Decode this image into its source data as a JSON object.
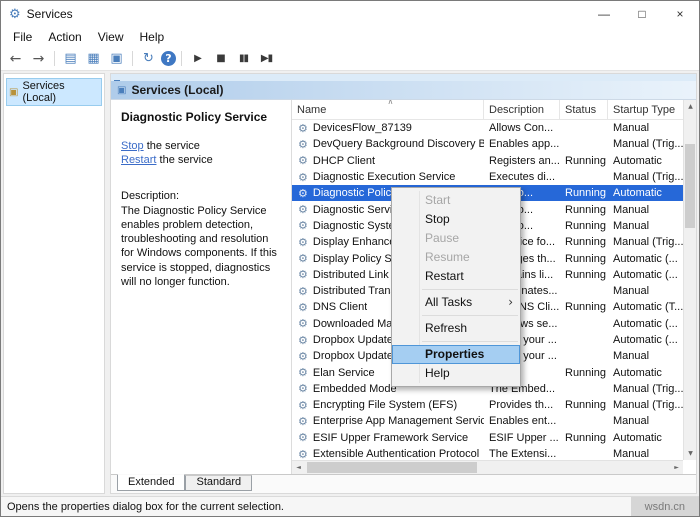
{
  "window": {
    "title": "Services",
    "controls": {
      "minimize": "—",
      "maximize": "□",
      "close": "×"
    }
  },
  "watermark": "wsdn.cn",
  "menubar": {
    "items": [
      "File",
      "Action",
      "View",
      "Help"
    ]
  },
  "toolbar": {
    "buttons": [
      {
        "name": "back",
        "glyph": "←"
      },
      {
        "name": "forward",
        "glyph": "→"
      },
      {
        "type": "separator"
      },
      {
        "name": "show-hide-console-tree",
        "glyph": "▤"
      },
      {
        "name": "export-list",
        "glyph": "▦"
      },
      {
        "name": "properties",
        "glyph": "▣"
      },
      {
        "type": "separator"
      },
      {
        "name": "refresh",
        "glyph": "↻"
      },
      {
        "name": "help",
        "glyph": "?"
      },
      {
        "type": "separator"
      },
      {
        "name": "start",
        "glyph": "▶"
      },
      {
        "name": "stop",
        "glyph": "■"
      },
      {
        "name": "pause",
        "glyph": "▮▮"
      },
      {
        "name": "restart",
        "glyph": "▶▮"
      }
    ]
  },
  "icons": {
    "service": "⚙",
    "tree_root": "▣",
    "header": "▣",
    "sort_ascending": "∧",
    "submenu_arrow": "›",
    "scroll_up": "▲",
    "scroll_down": "▼",
    "scroll_left": "◄",
    "scroll_right": "►"
  },
  "tree": {
    "root_label": "Services (Local)"
  },
  "header": {
    "title": "Services (Local)"
  },
  "detail": {
    "service_title": "Diagnostic Policy Service",
    "stop_link": "Stop",
    "stop_suffix": " the service",
    "restart_link": "Restart",
    "restart_suffix": " the service",
    "description_label": "Description:",
    "description": "The Diagnostic Policy Service enables problem detection, troubleshooting and resolution for Windows components.  If this service is stopped, diagnostics will no longer function."
  },
  "list": {
    "columns": [
      "Name",
      "Description",
      "Status",
      "Startup Type"
    ],
    "rows": [
      {
        "name": "DevicesFlow_87139",
        "description": "Allows Con...",
        "status": "",
        "startup": "Manual"
      },
      {
        "name": "DevQuery Background Discovery B...",
        "description": "Enables app...",
        "status": "",
        "startup": "Manual (Trig..."
      },
      {
        "name": "DHCP Client",
        "description": "Registers an...",
        "status": "Running",
        "startup": "Automatic"
      },
      {
        "name": "Diagnostic Execution Service",
        "description": "Executes di...",
        "status": "",
        "startup": "Manual (Trig..."
      },
      {
        "name": "Diagnostic Policy...",
        "description": "Diagno...",
        "status": "Running",
        "startup": "Automatic",
        "selected": true
      },
      {
        "name": "Diagnostic Servic...",
        "description": "Diagno...",
        "status": "Running",
        "startup": "Manual"
      },
      {
        "name": "Diagnostic Syste...",
        "description": "Diagno...",
        "status": "Running",
        "startup": "Manual"
      },
      {
        "name": "Display Enhance...",
        "description": "A service fo...",
        "status": "Running",
        "startup": "Manual (Trig..."
      },
      {
        "name": "Display Policy Se...",
        "description": "Manages th...",
        "status": "Running",
        "startup": "Automatic (..."
      },
      {
        "name": "Distributed Link ...",
        "description": "Maintains li...",
        "status": "Running",
        "startup": "Automatic (..."
      },
      {
        "name": "Distributed Trans...",
        "description": "Coordinates...",
        "status": "",
        "startup": "Manual"
      },
      {
        "name": "DNS Client",
        "description": "The DNS Cli...",
        "status": "Running",
        "startup": "Automatic (T..."
      },
      {
        "name": "Downloaded Ma...",
        "description": "Windows se...",
        "status": "",
        "startup": "Automatic (..."
      },
      {
        "name": "Dropbox Update ...",
        "description": "Keeps your ...",
        "status": "",
        "startup": "Automatic (..."
      },
      {
        "name": "Dropbox Update...",
        "description": "Keeps your ...",
        "status": "",
        "startup": "Manual"
      },
      {
        "name": "Elan Service",
        "description": "",
        "status": "Running",
        "startup": "Automatic"
      },
      {
        "name": "Embedded Mode",
        "description": "The Embed...",
        "status": "",
        "startup": "Manual (Trig..."
      },
      {
        "name": "Encrypting File System (EFS)",
        "description": "Provides th...",
        "status": "Running",
        "startup": "Manual (Trig..."
      },
      {
        "name": "Enterprise App Management Service",
        "description": "Enables ent...",
        "status": "",
        "startup": "Manual"
      },
      {
        "name": "ESIF Upper Framework Service",
        "description": "ESIF Upper ...",
        "status": "Running",
        "startup": "Automatic"
      },
      {
        "name": "Extensible Authentication Protocol",
        "description": "The Extensi...",
        "status": "",
        "startup": "Manual"
      }
    ]
  },
  "context_menu": {
    "items": [
      {
        "label": "Start",
        "disabled": true
      },
      {
        "label": "Stop"
      },
      {
        "label": "Pause",
        "disabled": true
      },
      {
        "label": "Resume",
        "disabled": true
      },
      {
        "label": "Restart"
      },
      {
        "type": "separator"
      },
      {
        "label": "All Tasks",
        "submenu": true
      },
      {
        "type": "separator"
      },
      {
        "label": "Refresh"
      },
      {
        "type": "separator"
      },
      {
        "label": "Properties",
        "highlighted": true,
        "bold": true
      },
      {
        "label": "Help"
      }
    ]
  },
  "tabs": {
    "items": [
      {
        "label": "Extended",
        "active": true
      },
      {
        "label": "Standard",
        "active": false
      }
    ]
  },
  "statusbar": {
    "text": "Opens the properties dialog box for the current selection."
  }
}
